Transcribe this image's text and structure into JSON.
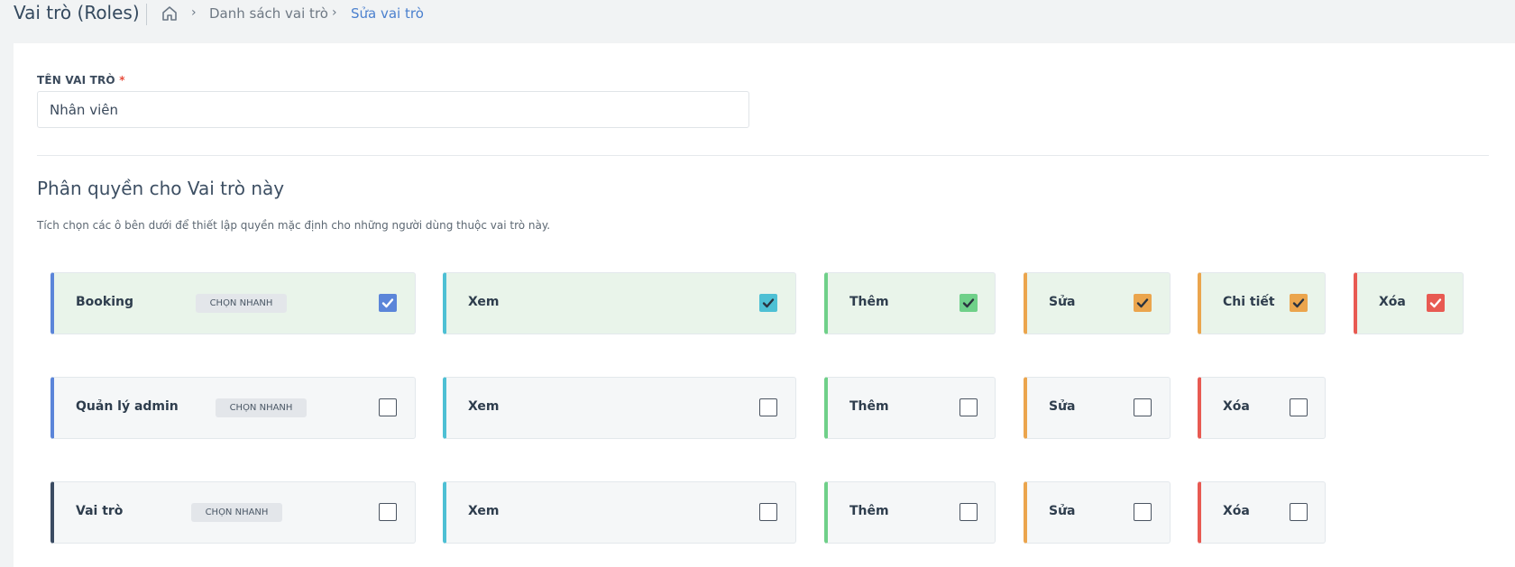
{
  "header": {
    "title": "Vai trò (Roles)",
    "breadcrumb": {
      "list": "Danh sách vai trò",
      "current": "Sửa vai trò"
    }
  },
  "form": {
    "name_label": "TÊN VAI TRÒ",
    "required_mark": "*",
    "name_value": "Nhân viên",
    "section_title": "Phân quyền cho Vai trò này",
    "section_desc": "Tích chọn các ô bên dưới để thiết lập quyền mặc định cho những người dùng thuộc vai trò này."
  },
  "colors": {
    "blue": "#5b85d9",
    "teal": "#4ec0d4",
    "green": "#6fd089",
    "orange": "#eba54d",
    "red": "#e85a52",
    "dark": "#3a4b62"
  },
  "permissions": {
    "quick_label": "CHỌN NHANH",
    "rows": [
      {
        "module": {
          "label": "Booking",
          "checked": true
        },
        "actions": [
          {
            "label": "Xem",
            "checked": true
          },
          {
            "label": "Thêm",
            "checked": true
          },
          {
            "label": "Sửa",
            "checked": true
          },
          {
            "label": "Chi tiết",
            "checked": true
          },
          {
            "label": "Xóa",
            "checked": true
          }
        ]
      },
      {
        "module": {
          "label": "Quản lý admin",
          "checked": false
        },
        "actions": [
          {
            "label": "Xem",
            "checked": false
          },
          {
            "label": "Thêm",
            "checked": false
          },
          {
            "label": "Sửa",
            "checked": false
          },
          {
            "label": "Xóa",
            "checked": false
          }
        ]
      },
      {
        "module": {
          "label": "Vai trò",
          "checked": false
        },
        "actions": [
          {
            "label": "Xem",
            "checked": false
          },
          {
            "label": "Thêm",
            "checked": false
          },
          {
            "label": "Sửa",
            "checked": false
          },
          {
            "label": "Xóa",
            "checked": false
          }
        ]
      }
    ]
  }
}
